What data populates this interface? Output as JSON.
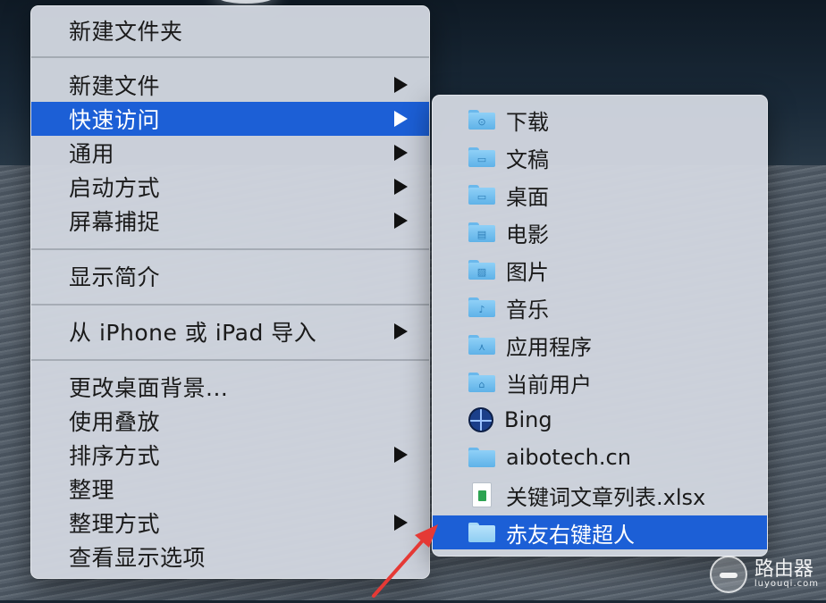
{
  "main_menu": {
    "items": [
      {
        "label": "新建文件夹",
        "has_submenu": false
      },
      {
        "label": "新建文件",
        "has_submenu": true
      },
      {
        "label": "快速访问",
        "has_submenu": true,
        "selected": true
      },
      {
        "label": "通用",
        "has_submenu": true
      },
      {
        "label": "启动方式",
        "has_submenu": true
      },
      {
        "label": "屏幕捕捉",
        "has_submenu": true
      },
      {
        "label": "显示简介",
        "has_submenu": false
      },
      {
        "label": "从 iPhone 或 iPad 导入",
        "has_submenu": true
      },
      {
        "label": "更改桌面背景...",
        "has_submenu": false
      },
      {
        "label": "使用叠放",
        "has_submenu": false
      },
      {
        "label": "排序方式",
        "has_submenu": true
      },
      {
        "label": "整理",
        "has_submenu": false
      },
      {
        "label": "整理方式",
        "has_submenu": true
      },
      {
        "label": "查看显示选项",
        "has_submenu": false
      }
    ]
  },
  "submenu": {
    "items": [
      {
        "label": "下载",
        "icon": "downloads-folder-icon",
        "glyph": "⊙"
      },
      {
        "label": "文稿",
        "icon": "documents-folder-icon",
        "glyph": "▭"
      },
      {
        "label": "桌面",
        "icon": "desktop-folder-icon",
        "glyph": "▭"
      },
      {
        "label": "电影",
        "icon": "movies-folder-icon",
        "glyph": "▤"
      },
      {
        "label": "图片",
        "icon": "pictures-folder-icon",
        "glyph": "▨"
      },
      {
        "label": "音乐",
        "icon": "music-folder-icon",
        "glyph": "♪"
      },
      {
        "label": "应用程序",
        "icon": "applications-folder-icon",
        "glyph": "⋏"
      },
      {
        "label": "当前用户",
        "icon": "home-folder-icon",
        "glyph": "⌂"
      },
      {
        "label": "Bing",
        "icon": "globe-icon"
      },
      {
        "label": "aibotech.cn",
        "icon": "folder-icon",
        "glyph": ""
      },
      {
        "label": "关键词文章列表.xlsx",
        "icon": "spreadsheet-file-icon"
      },
      {
        "label": "赤友右键超人",
        "icon": "folder-icon",
        "glyph": "",
        "selected": true
      }
    ]
  },
  "watermark": {
    "text": "路由器",
    "subtext": "luyouqi.com"
  },
  "colors": {
    "selection": "#1c5fd6",
    "menu_background": "#d0d5de",
    "annotation_arrow": "#e53935"
  }
}
